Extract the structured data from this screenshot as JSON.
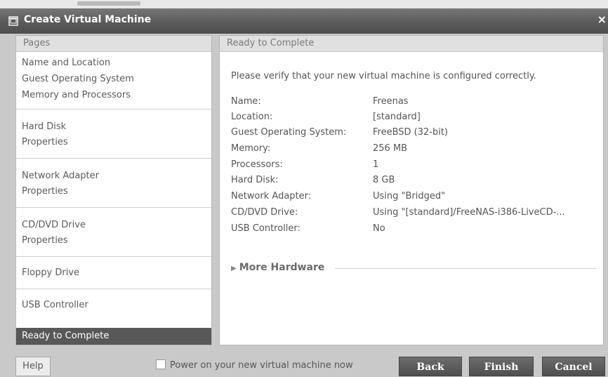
{
  "window": {
    "title": "Create Virtual Machine"
  },
  "pages_panel": {
    "header": "Pages",
    "groups": [
      [
        "Name and Location",
        "Guest Operating System",
        "Memory and Processors"
      ],
      [
        "Hard Disk",
        "Properties"
      ],
      [
        "Network Adapter",
        "Properties"
      ],
      [
        "CD/DVD Drive",
        "Properties"
      ],
      [
        "Floppy Drive"
      ],
      [
        "USB Controller"
      ]
    ],
    "selected": "Ready to Complete"
  },
  "summary": {
    "header": "Ready to Complete",
    "intro": "Please verify that your new virtual machine is configured correctly.",
    "rows": [
      {
        "label": "Name:",
        "value": "Freenas"
      },
      {
        "label": "Location:",
        "value": "[standard]"
      },
      {
        "label": "Guest Operating System:",
        "value": "FreeBSD (32-bit)"
      },
      {
        "label": "Memory:",
        "value": "256 MB"
      },
      {
        "label": "Processors:",
        "value": "1"
      },
      {
        "label": "Hard Disk:",
        "value": "8 GB"
      },
      {
        "label": "Network Adapter:",
        "value": "Using \"Bridged\""
      },
      {
        "label": "CD/DVD Drive:",
        "value": "Using \"[standard]/FreeNAS-i386-LiveCD-..."
      },
      {
        "label": "USB Controller:",
        "value": "No"
      }
    ],
    "more_hardware": "More Hardware"
  },
  "footer": {
    "help": "Help",
    "power_on_label": "Power on your new virtual machine now",
    "power_on_checked": false,
    "back": "Back",
    "finish": "Finish",
    "cancel": "Cancel"
  },
  "icons": {
    "window": "vm-window-icon",
    "close": "close-icon",
    "expand": "triangle-right-icon"
  },
  "colors": {
    "titlebar": "#5b5b5b",
    "selected_row": "#585858",
    "button_dark": "#5a5a5a"
  }
}
